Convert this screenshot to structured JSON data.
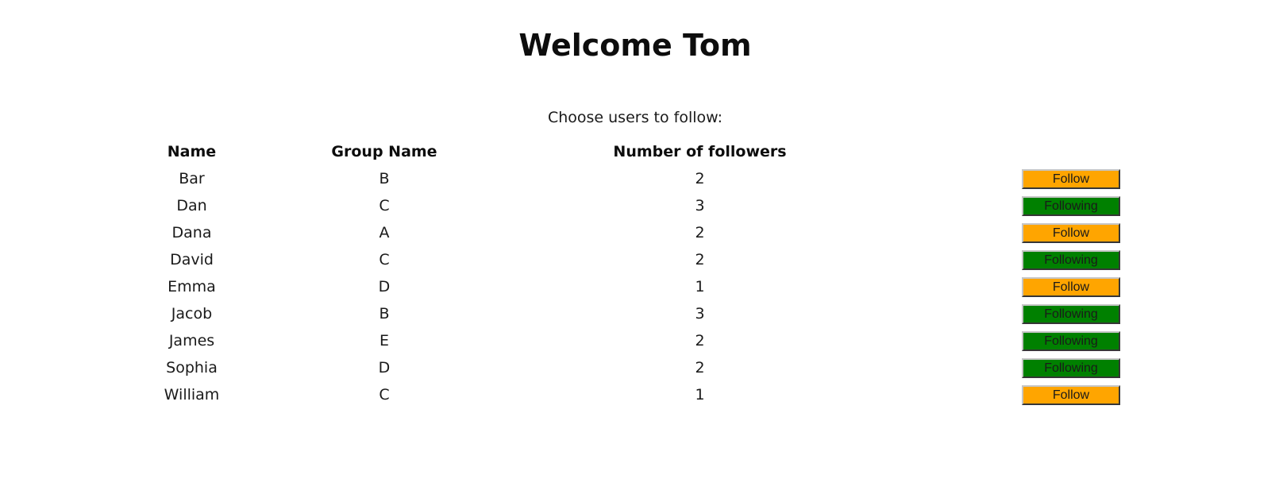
{
  "page": {
    "title": "Welcome Tom",
    "subtitle": "Choose users to follow:"
  },
  "table": {
    "headers": {
      "name": "Name",
      "group": "Group Name",
      "followers": "Number of followers",
      "action": ""
    },
    "rows": [
      {
        "name": "Bar",
        "group": "B",
        "followers": "2",
        "button": "Follow"
      },
      {
        "name": "Dan",
        "group": "C",
        "followers": "3",
        "button": "Following"
      },
      {
        "name": "Dana",
        "group": "A",
        "followers": "2",
        "button": "Follow"
      },
      {
        "name": "David",
        "group": "C",
        "followers": "2",
        "button": "Following"
      },
      {
        "name": "Emma",
        "group": "D",
        "followers": "1",
        "button": "Follow"
      },
      {
        "name": "Jacob",
        "group": "B",
        "followers": "3",
        "button": "Following"
      },
      {
        "name": "James",
        "group": "E",
        "followers": "2",
        "button": "Following"
      },
      {
        "name": "Sophia",
        "group": "D",
        "followers": "2",
        "button": "Following"
      },
      {
        "name": "William",
        "group": "C",
        "followers": "1",
        "button": "Follow"
      }
    ]
  },
  "colors": {
    "follow_button": "#ffa500",
    "following_button": "#008000"
  }
}
